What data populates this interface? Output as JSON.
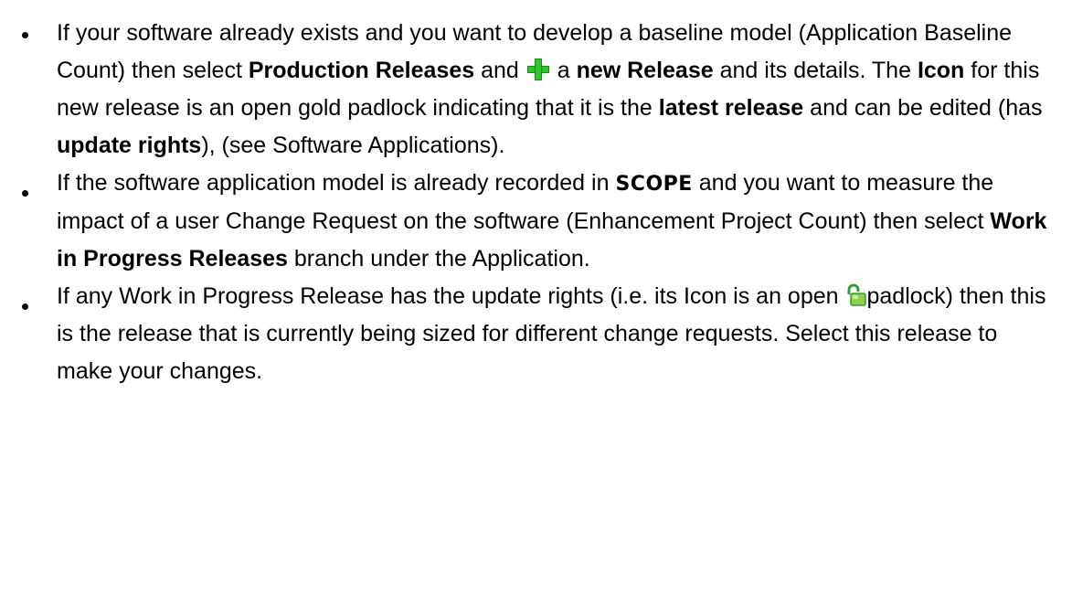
{
  "bullets": [
    {
      "segments": [
        {
          "text": "If your software already exists and you want to develop a baseline model (Application Baseline Count) then select ",
          "bold": false
        },
        {
          "text": "Production Releases",
          "bold": true
        },
        {
          "text": " and ",
          "bold": false
        },
        {
          "icon": "green-plus-icon"
        },
        {
          "text": " a ",
          "bold": false
        },
        {
          "text": "new Release",
          "bold": true
        },
        {
          "text": " and its details. The ",
          "bold": false
        },
        {
          "text": "Icon",
          "bold": true
        },
        {
          "text": " for this new release is an open gold padlock indicating that it is the ",
          "bold": false
        },
        {
          "text": "latest release",
          "bold": true
        },
        {
          "text": " and can be edited (has ",
          "bold": false
        },
        {
          "text": "update rights",
          "bold": true
        },
        {
          "text": "), (see Software Applications).",
          "bold": false
        }
      ]
    },
    {
      "segments": [
        {
          "text": "If the software application model is already recorded in ",
          "bold": false
        },
        {
          "text": "SCOPE",
          "bold": true,
          "style": "scope"
        },
        {
          "text": " and you want to measure the impact of a user Change Request on the software (Enhancement Project Count) then select ",
          "bold": false
        },
        {
          "text": "Work in Progress Releases",
          "bold": true
        },
        {
          "text": " branch under the Application.",
          "bold": false
        }
      ]
    },
    {
      "segments": [
        {
          "text": "If any Work in Progress Release has the update rights (i.e. its Icon is an open ",
          "bold": false
        },
        {
          "icon": "open-padlock-icon"
        },
        {
          "text": "padlock) then this is the release that is currently being sized for different change requests.  Select this release to make your changes.",
          "bold": false
        }
      ]
    }
  ],
  "colors": {
    "plus_icon": "#2fc42f",
    "padlock_body": "#8fd14f",
    "padlock_shackle": "#3a9a3a"
  }
}
